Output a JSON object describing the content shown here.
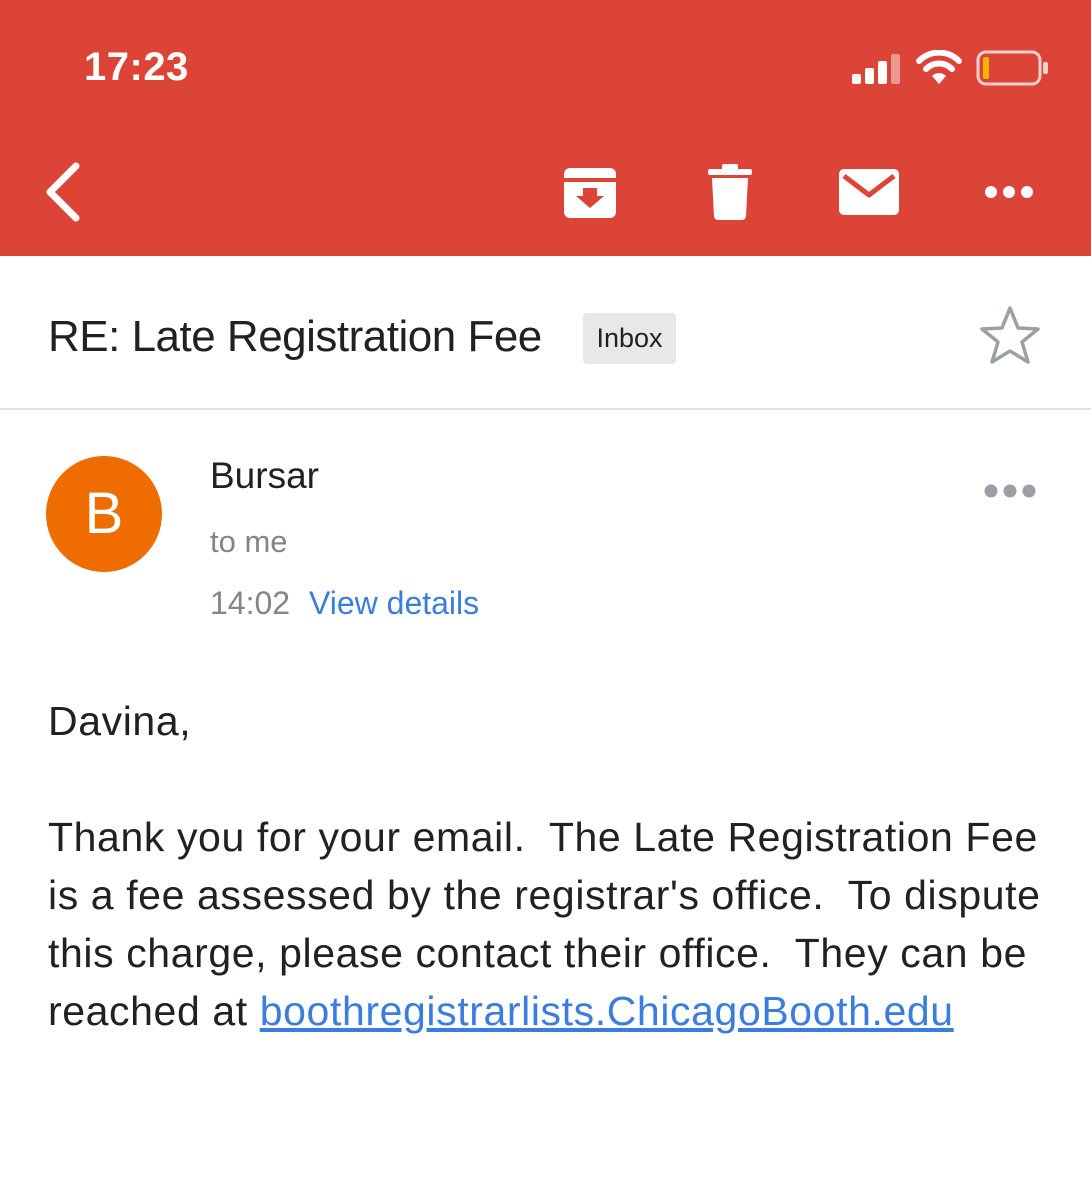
{
  "status_bar": {
    "time": "17:23"
  },
  "toolbar": {
    "back_icon": "back-arrow-icon",
    "archive_icon": "archive-icon",
    "delete_icon": "trash-icon",
    "mark_unread_icon": "envelope-icon",
    "more_icon": "more-horizontal-icon"
  },
  "email": {
    "subject": "RE: Late Registration Fee",
    "label": "Inbox",
    "sender": {
      "initial": "B",
      "name": "Bursar",
      "recipient": "to me",
      "time": "14:02",
      "details_link": "View details"
    },
    "body": {
      "salutation": "Davina,",
      "paragraph": "Thank you for your email.  The Late Registration Fee is a fee assessed by the registrar's office.  To dispute this charge, please contact their office.  They can be reached at ",
      "link": "boothregistrarlists.ChicagoBooth.edu"
    }
  },
  "colors": {
    "header": "#db4437",
    "avatar": "#ef6c00",
    "link": "#3b7ddd",
    "battery_low": "#f4b400"
  }
}
